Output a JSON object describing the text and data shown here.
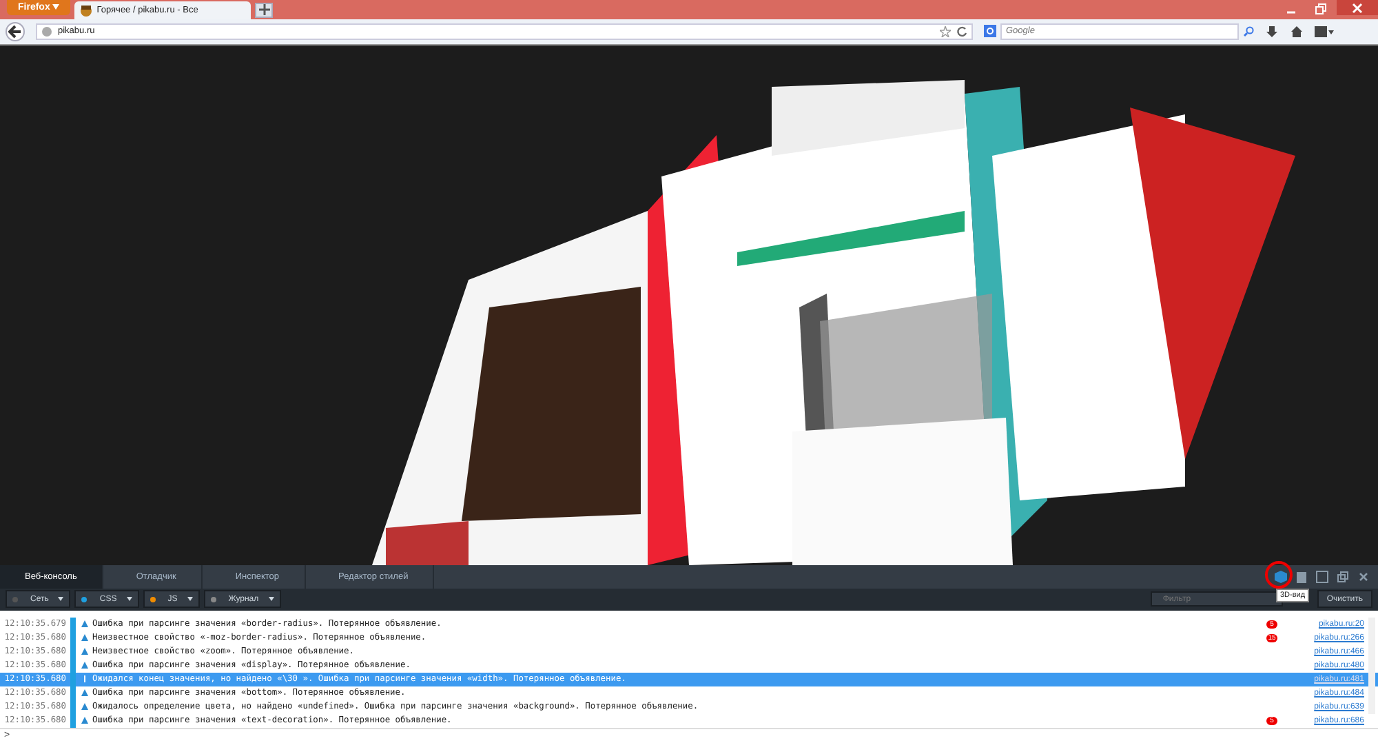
{
  "browser": {
    "menu_button": "Firefox",
    "tabs": [
      {
        "title": "Горячее / pikabu.ru - Все",
        "selected": true
      }
    ],
    "url": "pikabu.ru",
    "search_placeholder": "Google"
  },
  "devtools": {
    "tabs": [
      {
        "label": "Веб-консоль",
        "selected": true
      },
      {
        "label": "Отладчик",
        "selected": false
      },
      {
        "label": "Инспектор",
        "selected": false
      },
      {
        "label": "Редактор стилей",
        "selected": false
      }
    ],
    "filters": [
      {
        "label": "Сеть",
        "color": "#555555"
      },
      {
        "label": "CSS",
        "color": "#1fa0e0"
      },
      {
        "label": "JS",
        "color": "#f08c00"
      },
      {
        "label": "Журнал",
        "color": "#888888"
      }
    ],
    "filter_placeholder": "Фильтр",
    "tooltip": "3D-вид",
    "clear_button": "Очистить",
    "rows": [
      {
        "time": "12:10:35.679",
        "message": "Ошибка при парсинге значения «border-radius».  Потерянное объявление.",
        "count": "5",
        "source": "pikabu.ru:20",
        "selected": false
      },
      {
        "time": "12:10:35.680",
        "message": "Неизвестное свойство «-moz-border-radius».  Потерянное объявление.",
        "count": "15",
        "source": "pikabu.ru:266",
        "selected": false
      },
      {
        "time": "12:10:35.680",
        "message": "Неизвестное свойство «zoom».  Потерянное объявление.",
        "source": "pikabu.ru:466",
        "selected": false
      },
      {
        "time": "12:10:35.680",
        "message": "Ошибка при парсинге значения «display».  Потерянное объявление.",
        "source": "pikabu.ru:480",
        "selected": false
      },
      {
        "time": "12:10:35.680",
        "message": "Ожидался конец значения, но найдено «\\30 ».  Ошибка при парсинге значения «width».  Потерянное объявление.",
        "source": "pikabu.ru:481",
        "selected": true
      },
      {
        "time": "12:10:35.680",
        "message": "Ошибка при парсинге значения «bottom».  Потерянное объявление.",
        "source": "pikabu.ru:484",
        "selected": false
      },
      {
        "time": "12:10:35.680",
        "message": "Ожидалось определение цвета, но найдено «undefined».  Ошибка при парсинге значения «background».  Потерянное объявление.",
        "source": "pikabu.ru:639",
        "selected": false
      },
      {
        "time": "12:10:35.680",
        "message": "Ошибка при парсинге значения «text-decoration».  Потерянное объявление.",
        "count": "5",
        "source": "pikabu.ru:686",
        "selected": false
      }
    ],
    "prompt": ">"
  }
}
